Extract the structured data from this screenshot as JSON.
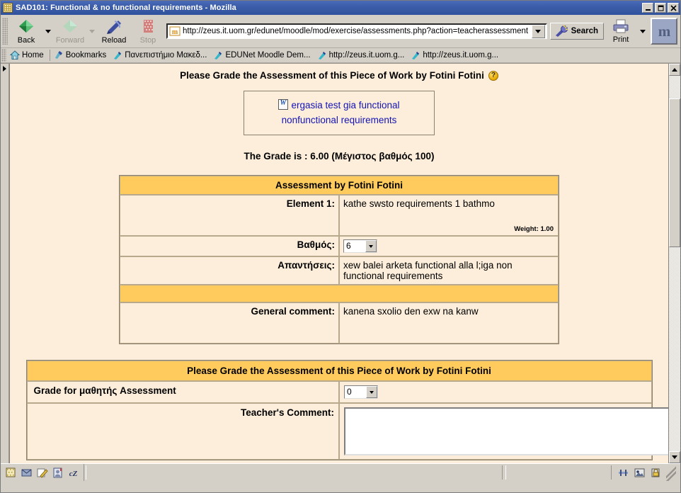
{
  "window": {
    "title": "SAD101: Functional & no functional requirements - Mozilla",
    "icon": "mozilla-app-icon",
    "minimize_label": "_",
    "maximize_label": "□",
    "close_label": "✕"
  },
  "toolbar": {
    "back_label": "Back",
    "forward_label": "Forward",
    "reload_label": "Reload",
    "stop_label": "Stop",
    "url": "http://zeus.it.uom.gr/edunet/moodle/mod/exercise/assessments.php?action=teacherassessment",
    "search_label": "Search",
    "print_label": "Print",
    "brand_logo_text": "m"
  },
  "bookmarks": [
    {
      "label": "Home",
      "icon": "home-icon"
    },
    {
      "label": "Bookmarks",
      "icon": "bookmark-folder-icon"
    },
    {
      "label": "Πανεπιστήμιο Μακεδ...",
      "icon": "bookmark-icon"
    },
    {
      "label": "EDUNet Moodle Dem...",
      "icon": "bookmark-icon"
    },
    {
      "label": "http://zeus.it.uom.g...",
      "icon": "bookmark-icon"
    },
    {
      "label": "http://zeus.it.uom.g...",
      "icon": "bookmark-icon"
    }
  ],
  "page": {
    "title": "Please Grade the Assessment of this Piece of Work by Fotini Fotini",
    "help_icon_label": "?",
    "submission_link": "ergasia test gia functional nonfunctional requirements",
    "grade_line": "The Grade is : 6.00 (Μέγιστος βαθμός 100)",
    "assessment_table": {
      "header": "Assessment by Fotini Fotini",
      "element_label": "Element 1:",
      "element_text": "kathe swsto requirements 1 bathmo",
      "weight_text": "Weight: 1.00",
      "grade_label": "Βαθμός:",
      "grade_value": "6",
      "responses_label": "Απαντήσεις:",
      "responses_value": "xew balei arketa functional alla l;iga non functional requirements",
      "general_comment_label": "General comment:",
      "general_comment_value": "kanena sxolio den exw na kanw"
    },
    "grading_form": {
      "header": "Please Grade the Assessment of this Piece of Work by Fotini Fotini",
      "grade_label": "Grade for μαθητής Assessment",
      "grade_value": "0",
      "teacher_comment_label": "Teacher's Comment:",
      "teacher_comment_value": ""
    }
  },
  "statusbar": {
    "message": "",
    "icons": [
      "mozilla-icon",
      "mail-icon",
      "composer-icon",
      "addressbook-icon",
      "irc-icon"
    ],
    "right_icons": [
      "cookie-icon",
      "image-icon",
      "security-lock-icon"
    ]
  },
  "colors": {
    "titlebar": "#3b5ca8",
    "chrome": "#d4d0c8",
    "page_bg": "#fceeda",
    "table_header": "#ffcb5c",
    "table_border": "#b9a98c",
    "link": "#1414b4"
  }
}
